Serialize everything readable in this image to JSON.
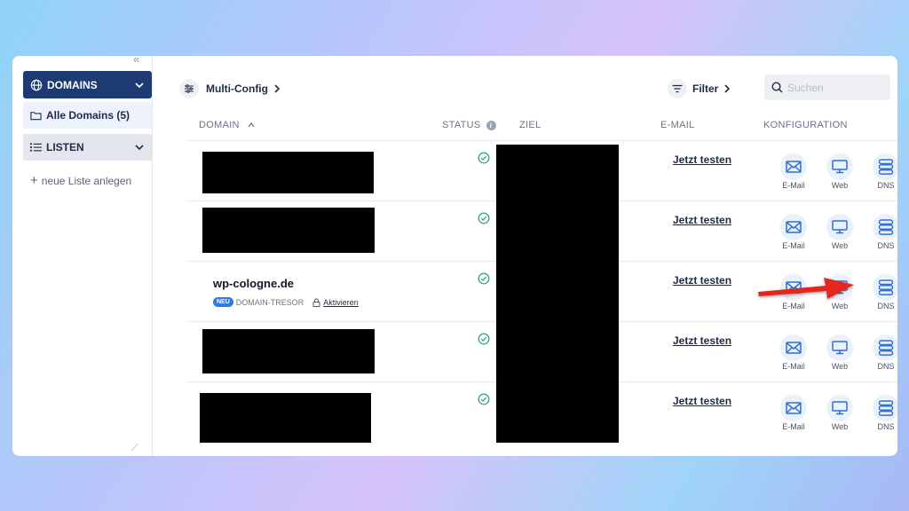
{
  "sidebar": {
    "collapse_label": "«",
    "collapse_bottom": "⟋",
    "domains_label": "DOMAINS",
    "alle_label": "Alle Domains (5)",
    "listen_label": "LISTEN",
    "new_list_label": "neue Liste anlegen"
  },
  "toolbar": {
    "multi_config_label": "Multi-Config",
    "filter_label": "Filter",
    "search_placeholder": "Suchen"
  },
  "table": {
    "headers": {
      "domain": "DOMAIN",
      "status": "STATUS",
      "ziel": "ZIEL",
      "email": "E-MAIL",
      "konfiguration": "KONFIGURATION"
    },
    "rows": [
      {
        "domain": "",
        "email_action": "Jetzt testen",
        "cfg": [
          "E-Mail",
          "Web",
          "DNS"
        ]
      },
      {
        "domain": "",
        "email_action": "Jetzt testen",
        "cfg": [
          "E-Mail",
          "Web",
          "DNS"
        ]
      },
      {
        "domain": "wp-cologne.de",
        "badge": "NEU",
        "tresor": "DOMAIN-TRESOR",
        "activate": "Aktivieren",
        "email_action": "Jetzt testen",
        "cfg": [
          "E-Mail",
          "Web",
          "DNS"
        ]
      },
      {
        "domain": "",
        "email_action": "Jetzt testen",
        "cfg": [
          "E-Mail",
          "Web",
          "DNS"
        ]
      },
      {
        "domain": "",
        "email_action": "Jetzt testen",
        "cfg": [
          "E-Mail",
          "Web",
          "DNS"
        ]
      }
    ]
  },
  "colors": {
    "sidebar_active": "#1e3a73",
    "status_ok": "#3aa57a",
    "icon_blue": "#2f6fd0",
    "arrow_red": "#e4261f"
  }
}
